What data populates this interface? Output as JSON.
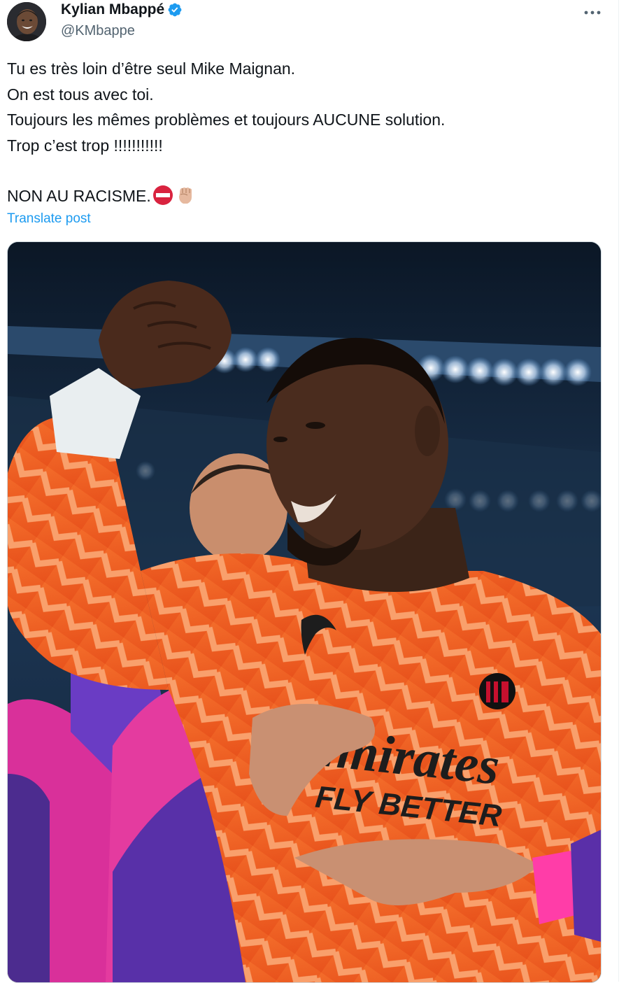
{
  "post": {
    "author": {
      "name": "Kylian Mbappé",
      "handle": "@KMbappe",
      "verified": true,
      "verified_icon": "verified-badge-icon",
      "avatar_icon": "avatar-photo"
    },
    "more_icon": "more-options-icon",
    "lines": [
      "Tu es très loin d’être seul Mike Maignan.",
      "On est tous avec toi.",
      "Toujours les mêmes problèmes et toujours AUCUNE solution.",
      "Trop c’est trop !!!!!!!!!!!",
      "",
      "NON AU RACISME."
    ],
    "emojis": [
      "no-entry-icon",
      "raised-fist-icon"
    ],
    "translate_label": "Translate post",
    "colors": {
      "link": "#1d9bf0",
      "verified": "#1d9bf0",
      "secondary_text": "#536471",
      "jersey": "#f06a2e",
      "jacket_pink": "#e8379b",
      "jacket_purple": "#5a2fa8"
    },
    "media": {
      "type": "photo",
      "sponsor_text_line1": "Emirates",
      "sponsor_text_line2": "FLY BETTER"
    }
  }
}
